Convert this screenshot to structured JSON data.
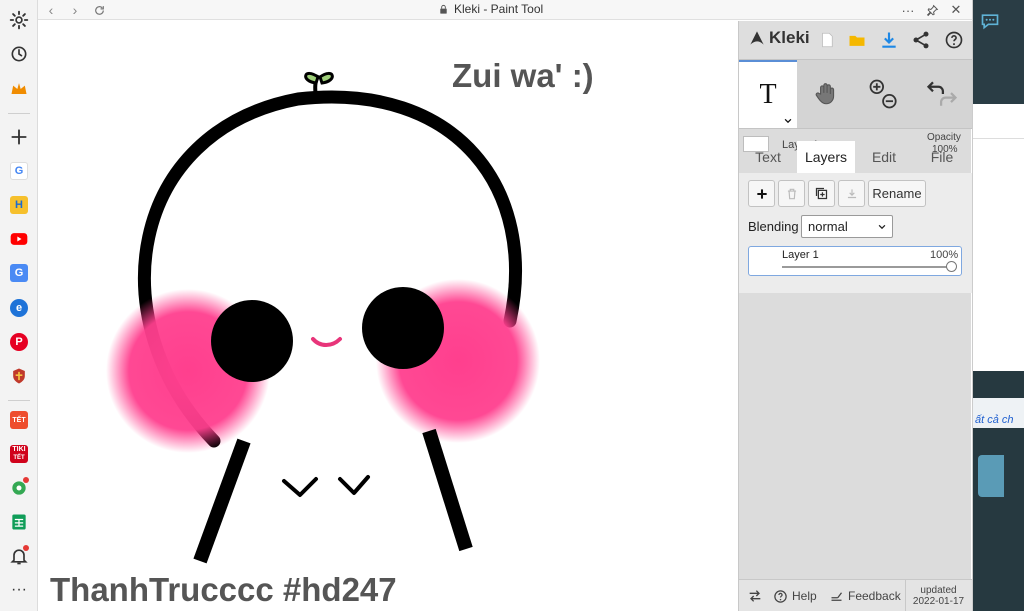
{
  "window": {
    "title": "Kleki - Paint Tool",
    "back_label": "‹",
    "forward_label": "›",
    "more_label": "···",
    "close_label": "✕"
  },
  "sidebar": {
    "items": [
      {
        "name": "settings-icon"
      },
      {
        "name": "history-icon"
      },
      {
        "name": "crown-icon"
      },
      {
        "name": "add-icon"
      },
      {
        "name": "google-icon"
      },
      {
        "name": "h-icon"
      },
      {
        "name": "youtube-icon"
      },
      {
        "name": "translate-icon"
      },
      {
        "name": "edge-icon"
      },
      {
        "name": "pinterest-icon"
      },
      {
        "name": "shield-icon"
      },
      {
        "name": "shopee-icon"
      },
      {
        "name": "tiki-icon"
      },
      {
        "name": "maps-icon"
      },
      {
        "name": "sheets-icon"
      },
      {
        "name": "bell-icon"
      },
      {
        "name": "more-icon"
      }
    ],
    "google_letter": "G",
    "h_letter": "H",
    "translate_letter": "G",
    "edge_letter": "e",
    "pinterest_letter": "P",
    "shopee_label": "TẾT",
    "tiki_label": "TIKI",
    "tiki_sub": "TẾT",
    "more_label": "···"
  },
  "canvas": {
    "caption_top": "Zui wa' :)",
    "caption_bottom": "ThanhTrucccc #hd247",
    "colors": {
      "line": "#000000",
      "blush": "#ff3f8e",
      "mouth": "#e8357a",
      "sprout": "#9fd07a",
      "text": "#555555"
    }
  },
  "panel": {
    "logo": "Kleki",
    "layer_label": "Layer 1",
    "opacity_label": "Opacity",
    "opacity_value": "100%",
    "tabs": [
      "Text",
      "Layers",
      "Edit",
      "File"
    ],
    "active_tab": "Layers",
    "rename_label": "Rename",
    "blending_label": "Blending",
    "blending_value": "normal",
    "layers": [
      {
        "name": "Layer 1",
        "opacity": "100%",
        "opacity_fraction": 1.0
      }
    ],
    "footer": {
      "help_label": "Help",
      "feedback_label": "Feedback",
      "updated_label": "updated",
      "updated_date": "2022-01-17"
    }
  },
  "rightweb": {
    "link_text": "ất cả ch"
  }
}
